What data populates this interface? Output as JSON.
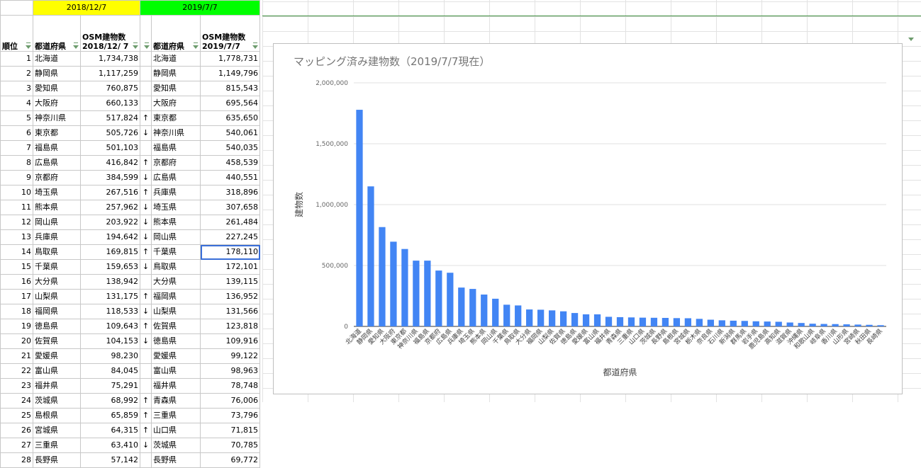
{
  "sheet": {
    "date_left": "2018/12/7",
    "date_right": "2019/7/7",
    "headers": {
      "rank": "順位",
      "pref_left": "都道府県",
      "osm_left": "OSM建物数 2018/12/ 7",
      "pref_right": "都道府県",
      "osm_right": "OSM建物数 2019/7/7"
    },
    "rows": [
      {
        "rank": "1",
        "pref_a": "北海道",
        "count_a": "1,734,738",
        "arrow": "",
        "pref_b": "北海道",
        "count_b": "1,778,731"
      },
      {
        "rank": "2",
        "pref_a": "静岡県",
        "count_a": "1,117,259",
        "arrow": "",
        "pref_b": "静岡県",
        "count_b": "1,149,796"
      },
      {
        "rank": "3",
        "pref_a": "愛知県",
        "count_a": "760,875",
        "arrow": "",
        "pref_b": "愛知県",
        "count_b": "815,543"
      },
      {
        "rank": "4",
        "pref_a": "大阪府",
        "count_a": "660,133",
        "arrow": "",
        "pref_b": "大阪府",
        "count_b": "695,564"
      },
      {
        "rank": "5",
        "pref_a": "神奈川県",
        "count_a": "517,824",
        "arrow": "↑",
        "pref_b": "東京都",
        "count_b": "635,650"
      },
      {
        "rank": "6",
        "pref_a": "東京都",
        "count_a": "505,726",
        "arrow": "↓",
        "pref_b": "神奈川県",
        "count_b": "540,061"
      },
      {
        "rank": "7",
        "pref_a": "福島県",
        "count_a": "501,103",
        "arrow": "",
        "pref_b": "福島県",
        "count_b": "540,035"
      },
      {
        "rank": "8",
        "pref_a": "広島県",
        "count_a": "416,842",
        "arrow": "↑",
        "pref_b": "京都府",
        "count_b": "458,539"
      },
      {
        "rank": "9",
        "pref_a": "京都府",
        "count_a": "384,599",
        "arrow": "↓",
        "pref_b": "広島県",
        "count_b": "440,551"
      },
      {
        "rank": "10",
        "pref_a": "埼玉県",
        "count_a": "267,516",
        "arrow": "↑",
        "pref_b": "兵庫県",
        "count_b": "318,896"
      },
      {
        "rank": "11",
        "pref_a": "熊本県",
        "count_a": "257,962",
        "arrow": "↓",
        "pref_b": "埼玉県",
        "count_b": "307,658"
      },
      {
        "rank": "12",
        "pref_a": "岡山県",
        "count_a": "203,922",
        "arrow": "↓",
        "pref_b": "熊本県",
        "count_b": "261,484"
      },
      {
        "rank": "13",
        "pref_a": "兵庫県",
        "count_a": "194,642",
        "arrow": "↓",
        "pref_b": "岡山県",
        "count_b": "227,245"
      },
      {
        "rank": "14",
        "pref_a": "鳥取県",
        "count_a": "169,815",
        "arrow": "↑",
        "pref_b": "千葉県",
        "count_b": "178,110"
      },
      {
        "rank": "15",
        "pref_a": "千葉県",
        "count_a": "159,653",
        "arrow": "↓",
        "pref_b": "鳥取県",
        "count_b": "172,101"
      },
      {
        "rank": "16",
        "pref_a": "大分県",
        "count_a": "138,942",
        "arrow": "",
        "pref_b": "大分県",
        "count_b": "139,115"
      },
      {
        "rank": "17",
        "pref_a": "山梨県",
        "count_a": "131,175",
        "arrow": "↑",
        "pref_b": "福岡県",
        "count_b": "136,952"
      },
      {
        "rank": "18",
        "pref_a": "福岡県",
        "count_a": "118,533",
        "arrow": "↓",
        "pref_b": "山梨県",
        "count_b": "131,566"
      },
      {
        "rank": "19",
        "pref_a": "徳島県",
        "count_a": "109,643",
        "arrow": "↑",
        "pref_b": "佐賀県",
        "count_b": "123,818"
      },
      {
        "rank": "20",
        "pref_a": "佐賀県",
        "count_a": "104,153",
        "arrow": "↓",
        "pref_b": "徳島県",
        "count_b": "109,916"
      },
      {
        "rank": "21",
        "pref_a": "愛媛県",
        "count_a": "98,230",
        "arrow": "",
        "pref_b": "愛媛県",
        "count_b": "99,122"
      },
      {
        "rank": "22",
        "pref_a": "富山県",
        "count_a": "84,045",
        "arrow": "",
        "pref_b": "富山県",
        "count_b": "98,963"
      },
      {
        "rank": "23",
        "pref_a": "福井県",
        "count_a": "75,291",
        "arrow": "",
        "pref_b": "福井県",
        "count_b": "78,748"
      },
      {
        "rank": "24",
        "pref_a": "茨城県",
        "count_a": "68,992",
        "arrow": "↑",
        "pref_b": "青森県",
        "count_b": "76,006"
      },
      {
        "rank": "25",
        "pref_a": "島根県",
        "count_a": "65,859",
        "arrow": "↑",
        "pref_b": "三重県",
        "count_b": "73,796"
      },
      {
        "rank": "26",
        "pref_a": "宮城県",
        "count_a": "64,315",
        "arrow": "↑",
        "pref_b": "山口県",
        "count_b": "71,815"
      },
      {
        "rank": "27",
        "pref_a": "三重県",
        "count_a": "63,410",
        "arrow": "↓",
        "pref_b": "茨城県",
        "count_b": "70,785"
      },
      {
        "rank": "28",
        "pref_a": "長野県",
        "count_a": "57,142",
        "arrow": "",
        "pref_b": "長野県",
        "count_b": "69,772"
      }
    ]
  },
  "chart_data": {
    "type": "bar",
    "title": "マッピング済み建物数（2019/7/7現在）",
    "xlabel": "都道府県",
    "ylabel": "建物数",
    "ylim": [
      0,
      2000000
    ],
    "yticks": [
      "0",
      "500,000",
      "1,000,000",
      "1,500,000",
      "2,000,000"
    ],
    "bar_color": "#4285f4",
    "categories": [
      "北海道",
      "静岡県",
      "愛知県",
      "大阪府",
      "東京都",
      "神奈川県",
      "福島県",
      "京都府",
      "広島県",
      "兵庫県",
      "埼玉県",
      "熊本県",
      "岡山県",
      "千葉県",
      "鳥取県",
      "大分県",
      "福岡県",
      "山梨県",
      "佐賀県",
      "徳島県",
      "愛媛県",
      "富山県",
      "福井県",
      "青森県",
      "三重県",
      "山口県",
      "茨城県",
      "長野県",
      "島根県",
      "宮城県",
      "栃木県",
      "奈良県",
      "石川県",
      "新潟県",
      "群馬県",
      "岩手県",
      "鹿児島県",
      "高知県",
      "滋賀県",
      "沖縄県",
      "和歌山県",
      "岐阜県",
      "香川県",
      "山形県",
      "宮崎県",
      "秋田県",
      "長崎県"
    ],
    "values": [
      1778731,
      1149796,
      815543,
      695564,
      635650,
      540061,
      540035,
      458539,
      440551,
      318896,
      307658,
      261484,
      227245,
      178110,
      172101,
      139115,
      136952,
      131566,
      123818,
      109916,
      99122,
      98963,
      78748,
      76006,
      73796,
      71815,
      70785,
      69772,
      68000,
      67000,
      62000,
      55000,
      50000,
      47000,
      45000,
      42000,
      40000,
      38000,
      32000,
      28000,
      22000,
      20000,
      19000,
      17000,
      15000,
      13000,
      10000
    ]
  }
}
